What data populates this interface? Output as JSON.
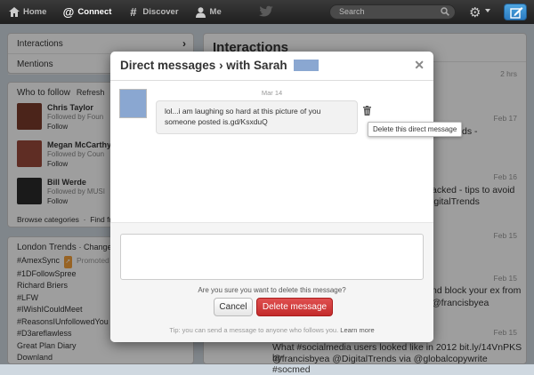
{
  "nav": {
    "home": "Home",
    "connect": "Connect",
    "discover": "Discover",
    "me": "Me",
    "search_placeholder": "Search"
  },
  "sidebar": {
    "interactions": "Interactions",
    "mentions": "Mentions",
    "who_to_follow": {
      "title": "Who to follow",
      "refresh": "Refresh",
      "footer_browse": "Browse categories",
      "footer_find": "Find frie",
      "people": [
        {
          "name": "Chris Taylor",
          "handle": "@C",
          "followed": "Followed by Foun",
          "action": "Follow",
          "color": "#7a3a2a"
        },
        {
          "name": "Megan McCarthy",
          "handle": "",
          "followed": "Followed by Coun",
          "action": "Follow",
          "color": "#9a4a3a"
        },
        {
          "name": "Bill Werde",
          "handle": "@twe",
          "followed": "Followed by MUSI",
          "action": "Follow",
          "color": "#2a2a2a"
        }
      ]
    },
    "trends": {
      "title": "London Trends",
      "change": "· Change",
      "promoted_label": "Promoted",
      "items": [
        "#AmexSync",
        "#1DFollowSpree",
        "Richard Briers",
        "#LFW",
        "#IWishICouldMeet",
        "#ReasonsIUnfollowedYou",
        "#D3areflawless",
        "Great Plan Diary",
        "Downland"
      ]
    }
  },
  "main": {
    "title": "Interactions",
    "items": [
      {
        "time": "2 hrs"
      },
      {
        "time": "Feb 17",
        "text": "play ads -"
      },
      {
        "time": "Feb 16",
        "text": "acked - tips to avoid",
        "text2": "igitalTrends"
      },
      {
        "time": "Feb 15"
      },
      {
        "time": "Feb 15",
        "text": "nd block your ex from",
        "text2": "@francisbyea"
      },
      {
        "time": "Feb 15",
        "text": "What #socialmedia users looked like in 2012 bit.ly/14VnPKS by",
        "text2": "@francisbyea @DigitalTrends via @globalcopywrite #socmed"
      }
    ]
  },
  "modal": {
    "title": "Direct messages › with Sarah",
    "date": "Mar 14",
    "message": "lol...i am laughing so hard at this picture of you someone posted is.gd/KsxduQ",
    "tooltip": "Delete this direct message",
    "confirm": "Are you sure you want to delete this message?",
    "cancel": "Cancel",
    "delete": "Delete message",
    "tip": "Tip: you can send a message to anyone who follows you.",
    "learn_more": "Learn more"
  },
  "colors": {
    "delete_red": "#c32b2b",
    "compose_blue": "#2b7bc1",
    "redaction": "#8aa7d1"
  }
}
